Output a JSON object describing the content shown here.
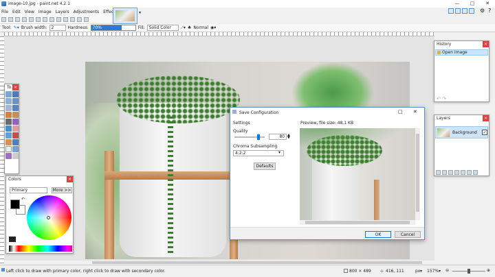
{
  "window": {
    "title": "image-10.jpg - paint.net 4.2.1",
    "min_glyph": "—",
    "max_glyph": "□",
    "close_glyph": "✕"
  },
  "menu": [
    "File",
    "Edit",
    "View",
    "Image",
    "Layers",
    "Adjustments",
    "Effects"
  ],
  "toolbar": {
    "tool_label": "Tool:",
    "brush_width_label": "Brush width:",
    "brush_width_value": "2",
    "hardness_label": "Hardness:",
    "hardness_value": "70%",
    "hardness_fraction": 0.7,
    "fill_label": "Fill:",
    "fill_value": "Solid Color",
    "blend_value": "Normal"
  },
  "tools_panel": {
    "title": "To..."
  },
  "colors_panel": {
    "title": "Colors",
    "mode": "Primary",
    "more_label": "More >>",
    "primary_color": "#000000",
    "secondary_color": "#ffffff"
  },
  "history_panel": {
    "title": "History",
    "items": [
      "Open Image"
    ]
  },
  "layers_panel": {
    "title": "Layers",
    "items": [
      {
        "name": "Background",
        "visible": true
      }
    ]
  },
  "dialog": {
    "title": "Save Configuration",
    "settings_label": "Settings",
    "quality_label": "Quality",
    "quality_value": "80",
    "quality_fraction": 0.8,
    "chroma_label": "Chroma Subsampling",
    "chroma_value": "4:2:2",
    "defaults_label": "Defaults",
    "preview_label": "Preview, file size: 48.1 KB",
    "ok_label": "OK",
    "cancel_label": "Cancel"
  },
  "status": {
    "hint": "Left click to draw with primary color, right click to draw with secondary color.",
    "image_size": "800 × 489",
    "cursor_pos": "416, 111",
    "units": "px",
    "zoom": "157%"
  },
  "colors": {
    "accent": "#0078d7",
    "hardness_fill": "#2b79d8",
    "close_red": "#e04040"
  }
}
